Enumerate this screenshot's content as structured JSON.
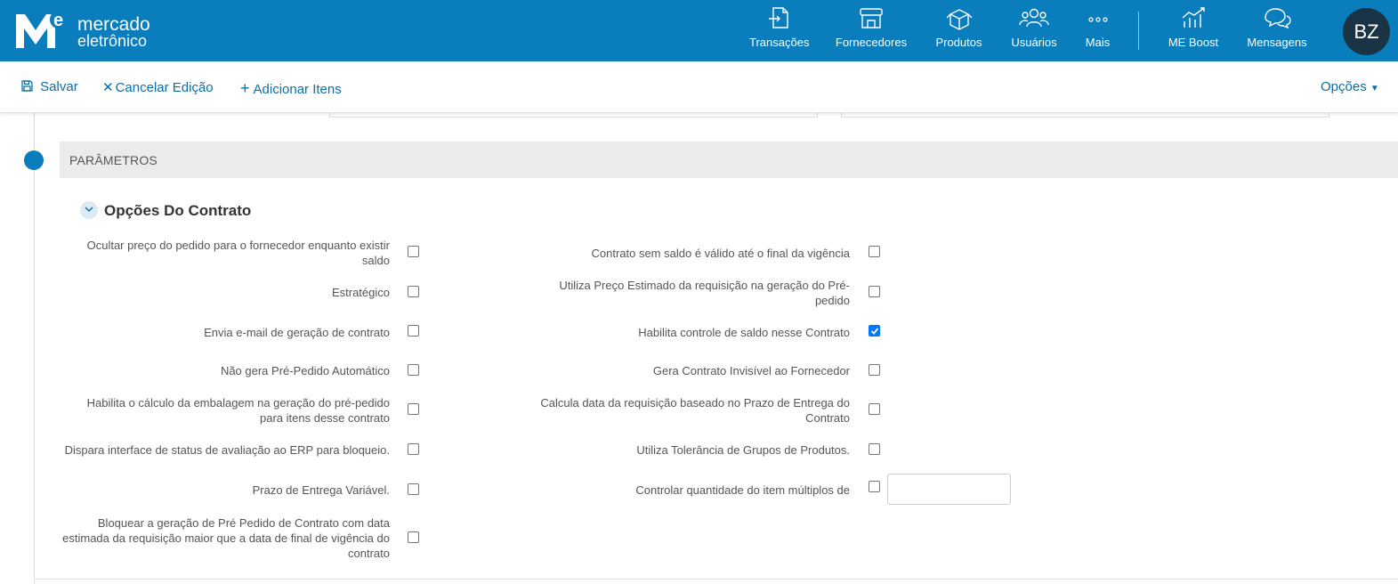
{
  "brand": {
    "line1": "mercado",
    "line2": "eletrônico"
  },
  "nav": [
    {
      "label": "Transações",
      "icon": "transactions-icon"
    },
    {
      "label": "Fornecedores",
      "icon": "store-icon"
    },
    {
      "label": "Produtos",
      "icon": "box-icon"
    },
    {
      "label": "Usuários",
      "icon": "users-icon"
    },
    {
      "label": "Mais",
      "icon": "more-icon"
    },
    {
      "label": "ME Boost",
      "icon": "chart-icon"
    },
    {
      "label": "Mensagens",
      "icon": "chat-icon"
    }
  ],
  "user": {
    "initials": "BZ"
  },
  "toolbar": {
    "save": "Salvar",
    "cancel": "Cancelar Edição",
    "add": "Adicionar Itens",
    "options": "Opções"
  },
  "section": {
    "title": "PARÂMETROS"
  },
  "group": {
    "title": "Opções Do Contrato"
  },
  "options_left": [
    {
      "label": "Ocultar preço do pedido para o fornecedor enquanto existir saldo",
      "checked": false
    },
    {
      "label": "Estratégico",
      "checked": false
    },
    {
      "label": "Envia e-mail de geração de contrato",
      "checked": false
    },
    {
      "label": "Não gera Pré-Pedido Automático",
      "checked": false
    },
    {
      "label": "Habilita o cálculo da embalagem na geração do pré-pedido para itens desse contrato",
      "checked": false
    },
    {
      "label": "Dispara interface de status de avaliação ao ERP para bloqueio.",
      "checked": false
    },
    {
      "label": "Prazo de Entrega Variável.",
      "checked": false
    },
    {
      "label": "Bloquear a geração de Pré Pedido de Contrato com data estimada da requisição maior que a data de final de vigência do contrato",
      "checked": false
    }
  ],
  "options_right": [
    {
      "label": "Contrato sem saldo é válido até o final da vigência",
      "checked": false
    },
    {
      "label": "Utiliza Preço Estimado da requisição na geração do Pré-pedido",
      "checked": false
    },
    {
      "label": "Habilita controle de saldo nesse Contrato",
      "checked": true
    },
    {
      "label": "Gera Contrato Invisível ao Fornecedor",
      "checked": false
    },
    {
      "label": "Calcula data da requisição baseado no Prazo de Entrega do Contrato",
      "checked": false
    },
    {
      "label": "Utiliza Tolerância de Grupos de Produtos.",
      "checked": false
    },
    {
      "label": "Controlar quantidade do item múltiplos de",
      "checked": false,
      "input_value": ""
    }
  ]
}
